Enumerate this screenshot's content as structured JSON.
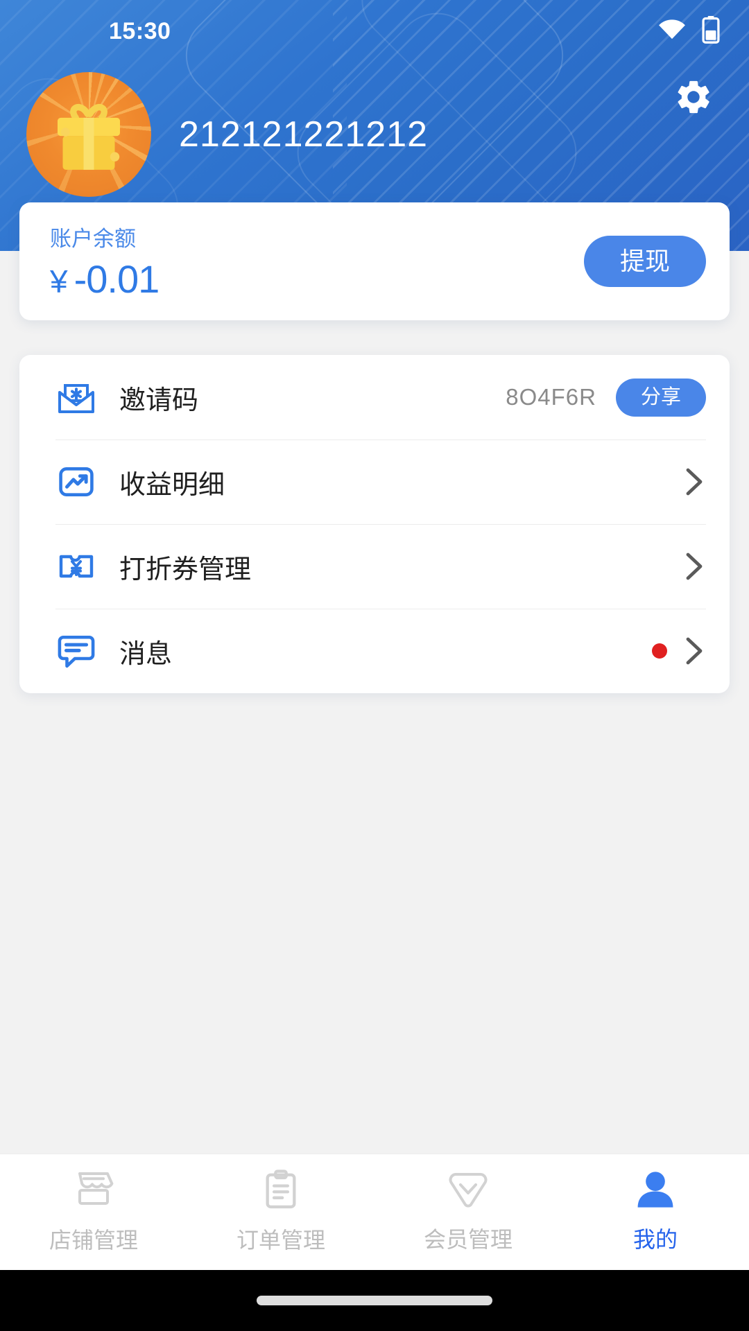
{
  "status_bar": {
    "time": "15:30",
    "wifi_icon": "wifi-icon",
    "battery_icon": "battery-icon"
  },
  "header": {
    "settings_icon": "gear-icon",
    "avatar_icon": "gift-box-avatar",
    "username": "212121221212",
    "bg_color": "#2f74cf"
  },
  "balance": {
    "label": "账户余额",
    "currency": "¥",
    "amount": "-0.01",
    "withdraw_label": "提现",
    "accent_color": "#4a86e8",
    "text_color": "#2f7ae5"
  },
  "menu": {
    "items": [
      {
        "icon": "envelope-star-icon",
        "label": "邀请码",
        "value": "8O4F6R",
        "action_label": "分享",
        "has_chevron": false,
        "has_badge": false
      },
      {
        "icon": "trending-chart-icon",
        "label": "收益明细",
        "value": "",
        "action_label": "",
        "has_chevron": true,
        "has_badge": false
      },
      {
        "icon": "coupon-yen-icon",
        "label": "打折券管理",
        "value": "",
        "action_label": "",
        "has_chevron": true,
        "has_badge": false
      },
      {
        "icon": "message-bubble-icon",
        "label": "消息",
        "value": "",
        "action_label": "",
        "has_chevron": true,
        "has_badge": true
      }
    ],
    "badge_color": "#e02020"
  },
  "bottom_nav": {
    "active_color": "#2563eb",
    "inactive_color": "#bdbdbd",
    "items": [
      {
        "icon": "storefront-icon",
        "label": "店铺管理",
        "active": false
      },
      {
        "icon": "clipboard-icon",
        "label": "订单管理",
        "active": false
      },
      {
        "icon": "diamond-member-icon",
        "label": "会员管理",
        "active": false
      },
      {
        "icon": "person-icon",
        "label": "我的",
        "active": true
      }
    ]
  }
}
